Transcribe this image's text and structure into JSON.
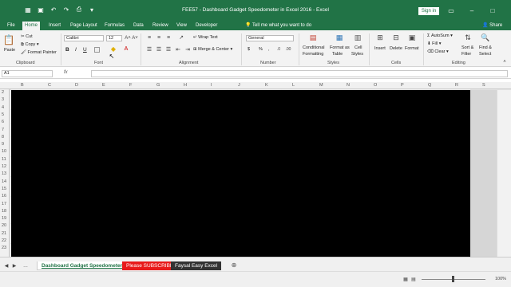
{
  "titlebar": {
    "title": "FEE57 - Dashboard Gadget Speedometer in Excel 2016  -  Excel",
    "signin": "Sign in"
  },
  "tabs": [
    "File",
    "Home",
    "Insert",
    "Page Layout",
    "Formulas",
    "Data",
    "Review",
    "View",
    "Developer"
  ],
  "tell_me": "Tell me what you want to do",
  "share": "Share",
  "ribbon": {
    "paste": "Paste",
    "cut": "Cut",
    "copy": "Copy",
    "format_painter": "Format Painter",
    "clipboard": "Clipboard",
    "font_name": "Calibri",
    "font_size": "12",
    "font_group": "Font",
    "bold": "B",
    "italic": "I",
    "underline": "U",
    "wrap_text": "Wrap Text",
    "merge_center": "Merge & Center",
    "alignment": "Alignment",
    "number_format": "General",
    "currency": "$",
    "percent": "%",
    "comma": ",",
    "number": "Number",
    "conditional_formatting_1": "Conditional",
    "conditional_formatting_2": "Formatting",
    "format_as_table_1": "Format as",
    "format_as_table_2": "Table",
    "cell_styles_1": "Cell",
    "cell_styles_2": "Styles",
    "styles": "Styles",
    "insert": "Insert",
    "delete": "Delete",
    "format": "Format",
    "cells": "Cells",
    "autosum": "AutoSum",
    "fill": "Fill",
    "clear": "Clear",
    "sort_filter_1": "Sort &",
    "sort_filter_2": "Filter",
    "find_select_1": "Find &",
    "find_select_2": "Select",
    "editing": "Editing"
  },
  "formula_bar": {
    "name_box": "A1",
    "fx": "fx",
    "value": ""
  },
  "columns": [
    "B",
    "C",
    "D",
    "E",
    "F",
    "G",
    "H",
    "I",
    "J",
    "K",
    "L",
    "M",
    "N",
    "O",
    "P",
    "Q",
    "R",
    "S"
  ],
  "rows": [
    "2",
    "3",
    "4",
    "5",
    "6",
    "7",
    "8",
    "9",
    "10",
    "11",
    "12",
    "13",
    "14",
    "15",
    "16",
    "17",
    "18",
    "19",
    "20",
    "21",
    "22",
    "23"
  ],
  "sheets": {
    "active": "Dashboard Gadget Speedometer",
    "subscribe": "Please SUBSCRIBE",
    "faysal": "Faysal Easy Excel"
  },
  "status": {
    "zoom": "100%"
  },
  "colors": {
    "excel_green": "#217346",
    "subscribe_red": "#e81b1b"
  }
}
